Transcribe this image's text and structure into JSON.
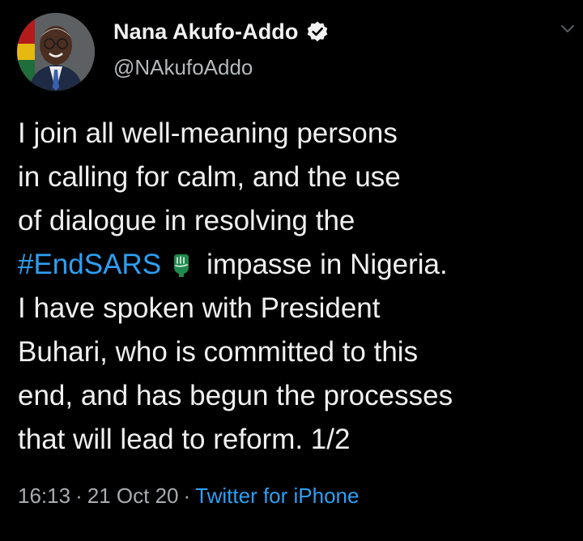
{
  "author": {
    "display_name": "Nana Akufo-Addo",
    "handle": "@NAkufoAddo",
    "verified_icon": "verified-badge-icon",
    "avatar_icon": "profile-photo"
  },
  "tweet": {
    "lines": [
      {
        "text": "I join all well-meaning persons"
      },
      {
        "text": "in calling for calm, and the use"
      },
      {
        "text": "of dialogue in resolving the"
      },
      {
        "hashtag": "#EndSARS",
        "rest": "impasse in Nigeria."
      },
      {
        "text": "I have spoken with President"
      },
      {
        "text": "Buhari, who is committed to this"
      },
      {
        "text": "end, and has begun the processes"
      },
      {
        "text": "that will lead to reform. 1/2"
      }
    ],
    "hashflag_icon": "endsars-fist-icon"
  },
  "meta": {
    "time": "16:13",
    "date": "21 Oct 20",
    "separator": "·",
    "source": "Twitter for iPhone"
  },
  "colors": {
    "background": "#000000",
    "link": "#2d9ff3",
    "text": "#f0f0f0",
    "muted": "#a9acb0",
    "hashflag_green": "#1f8a4c"
  }
}
